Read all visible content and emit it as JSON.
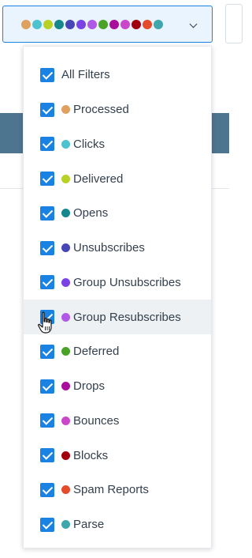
{
  "trigger": {
    "dot_colors": [
      "#dea15f",
      "#4fc2cf",
      "#b7d124",
      "#14888a",
      "#4646b7",
      "#7a43e6",
      "#b159e7",
      "#4ba228",
      "#a90f9b",
      "#cb47c9",
      "#a2000f",
      "#e34b2a",
      "#3fa6ac"
    ],
    "chevron_icon": "chevron-down-icon"
  },
  "filters": [
    {
      "label": "All Filters",
      "checked": true,
      "color": null
    },
    {
      "label": "Processed",
      "checked": true,
      "color": "#dea15f"
    },
    {
      "label": "Clicks",
      "checked": true,
      "color": "#4fc2cf"
    },
    {
      "label": "Delivered",
      "checked": true,
      "color": "#b7d124"
    },
    {
      "label": "Opens",
      "checked": true,
      "color": "#14888a"
    },
    {
      "label": "Unsubscribes",
      "checked": true,
      "color": "#4646b7"
    },
    {
      "label": "Group Unsubscribes",
      "checked": true,
      "color": "#7a43e6"
    },
    {
      "label": "Group Resubscribes",
      "checked": true,
      "color": "#b159e7"
    },
    {
      "label": "Deferred",
      "checked": true,
      "color": "#4ba228"
    },
    {
      "label": "Drops",
      "checked": true,
      "color": "#a90f9b"
    },
    {
      "label": "Bounces",
      "checked": true,
      "color": "#cb47c9"
    },
    {
      "label": "Blocks",
      "checked": true,
      "color": "#a2000f"
    },
    {
      "label": "Spam Reports",
      "checked": true,
      "color": "#e34b2a"
    },
    {
      "label": "Parse",
      "checked": true,
      "color": "#3fa6ac"
    }
  ],
  "hovered_item": "Group Resubscribes",
  "colors": {
    "accent": "#1a82e2",
    "header_band": "#4e7590"
  }
}
